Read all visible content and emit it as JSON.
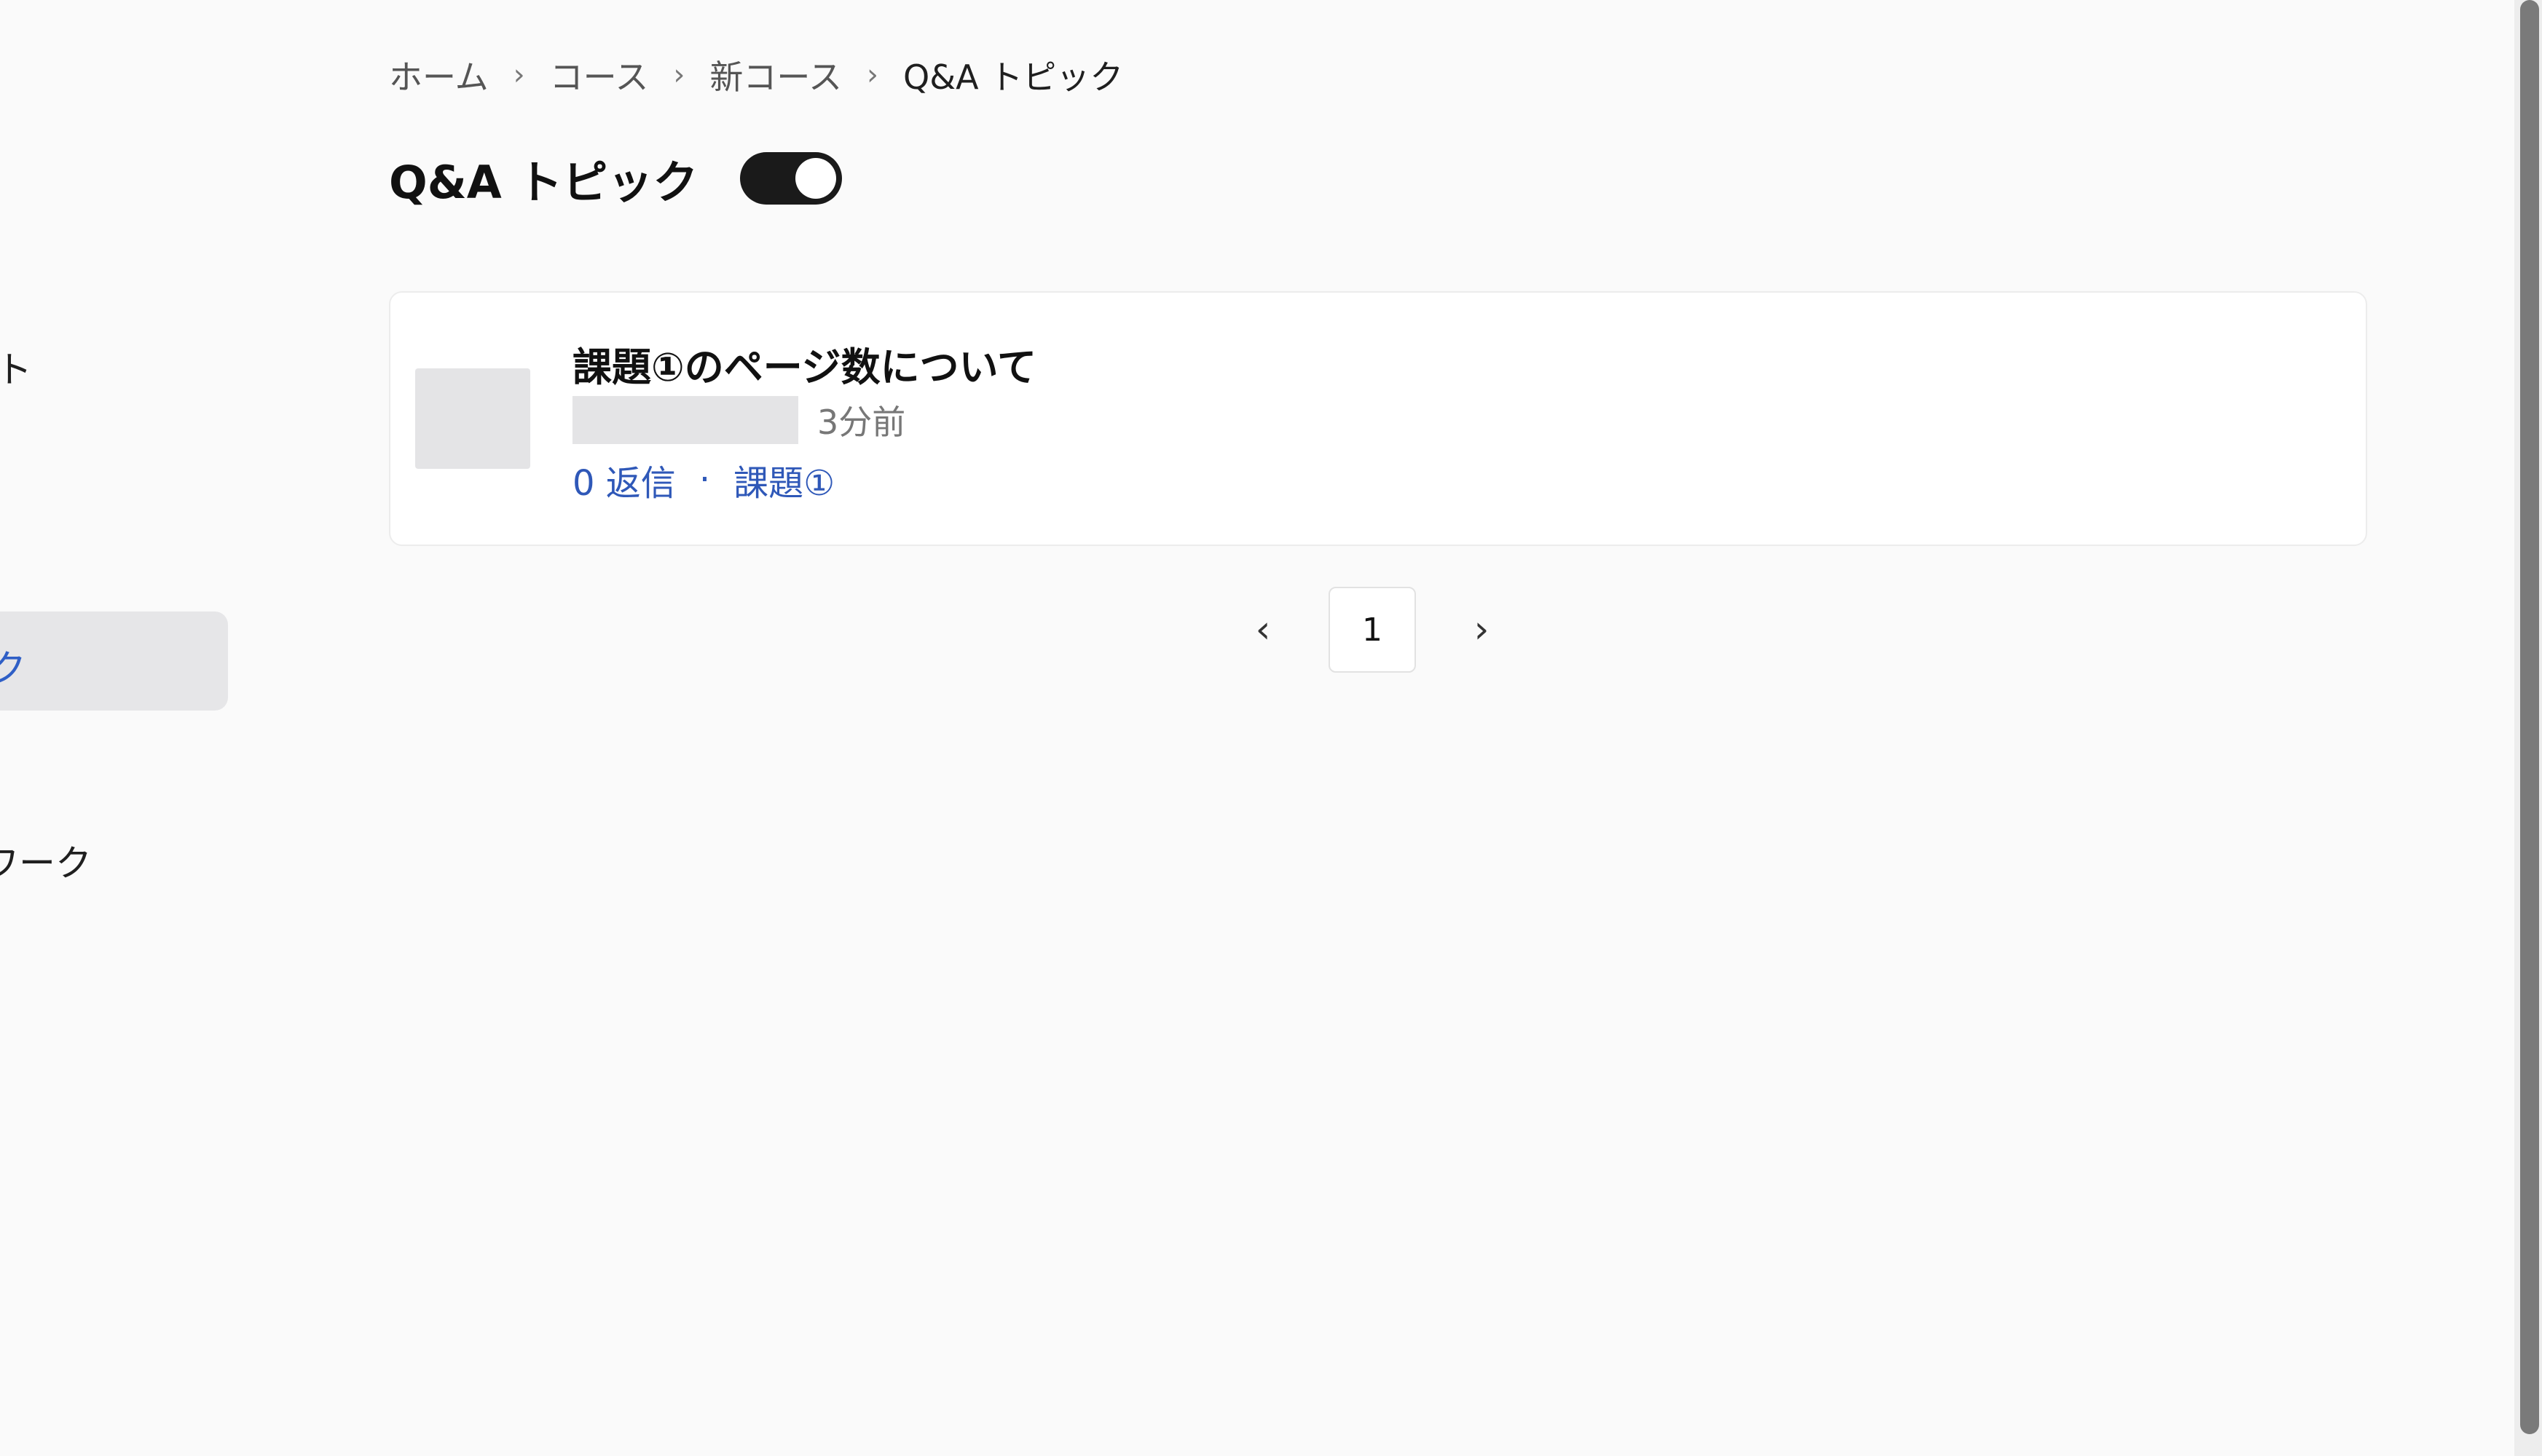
{
  "sidebar": {
    "partial_top_label": "ト",
    "active_item_label": "ク",
    "bottom_item_label": "ワーク"
  },
  "breadcrumb": {
    "items": [
      "ホーム",
      "コース",
      "新コース"
    ],
    "current": "Q&A トピック",
    "separator": "›"
  },
  "header": {
    "title": "Q&A トピック",
    "toggle_on": true
  },
  "topic": {
    "title": "課題①のページ数について",
    "time_ago": "3分前",
    "replies": "0 返信",
    "dot": "·",
    "tag": "課題①"
  },
  "pagination": {
    "prev": "‹",
    "current_page": "1",
    "next": "›"
  },
  "colors": {
    "link_blue": "#2f58b8",
    "toggle_dark": "#1a1a1a",
    "background": "#fafafa"
  }
}
